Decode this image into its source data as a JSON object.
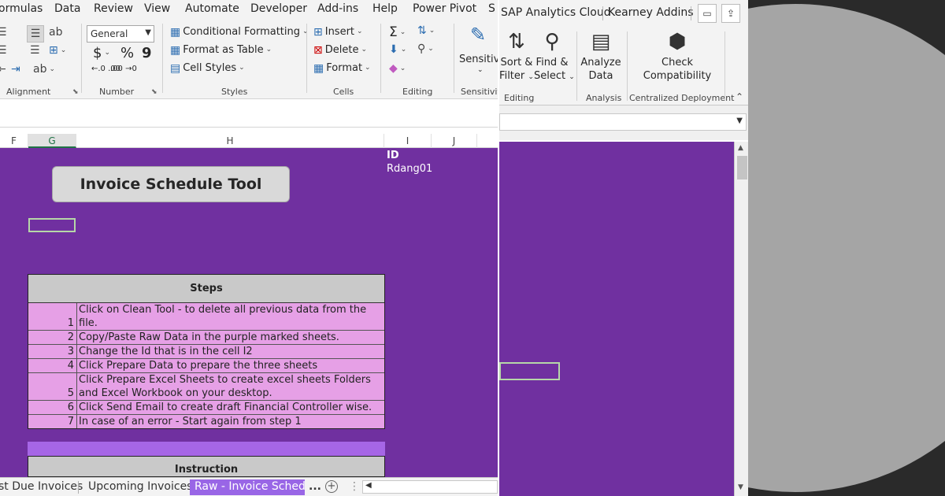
{
  "left_window": {
    "menu_tabs": [
      "ormulas",
      "Data",
      "Review",
      "View",
      "Automate",
      "Developer",
      "Add-ins",
      "Help",
      "Power Pivot",
      "S"
    ],
    "ribbon": {
      "number_format_value": "General",
      "group_labels": {
        "alignment": "Alignment",
        "number": "Number",
        "styles": "Styles",
        "cells": "Cells",
        "editing": "Editing",
        "sensitivity": "Sensitivit"
      },
      "styles_items": [
        "Conditional Formatting",
        "Format as Table",
        "Cell Styles"
      ],
      "cells_items": [
        "Insert",
        "Delete",
        "Format"
      ],
      "number_symbols": [
        "$",
        "%",
        "9"
      ],
      "sensitivity_label": "Sensitivit"
    },
    "columns": [
      "F",
      "G",
      "H",
      "I",
      "J"
    ],
    "sheet": {
      "title": "Invoice Schedule Tool",
      "id_label": "ID",
      "id_value": "Rdang01",
      "steps_header": "Steps",
      "steps": [
        {
          "num": "1",
          "text": "Click on Clean Tool - to delete all previous data from the file."
        },
        {
          "num": "2",
          "text": "Copy/Paste Raw Data in the purple marked sheets."
        },
        {
          "num": "3",
          "text": "Change the Id that is in the cell I2"
        },
        {
          "num": "4",
          "text": "Click Prepare Data to prepare the three sheets"
        },
        {
          "num": "5",
          "text": "Click Prepare Excel Sheets to create excel sheets Folders and Excel Workbook on your desktop."
        },
        {
          "num": "6",
          "text": "Click Send Email to create draft Financial Controller wise."
        },
        {
          "num": "7",
          "text": "In case of an error - Start again from step 1"
        }
      ],
      "instruction_header": "Instruction"
    },
    "sheet_tabs": {
      "tab1": "st Due Invoices",
      "tab2": "Upcoming Invoices",
      "tab3": "Raw - Invoice Schedule",
      "more": "..."
    }
  },
  "right_window": {
    "top_tabs": [
      "SAP Analytics Cloud",
      "Kearney Addins"
    ],
    "buttons": {
      "sort_filter": [
        "Sort &",
        "Filter"
      ],
      "find_select": [
        "Find &",
        "Select"
      ],
      "analyze_data": [
        "Analyze",
        "Data"
      ],
      "check_compat": [
        "Check",
        "Compatibility"
      ]
    },
    "group_labels": {
      "editing": "Editing",
      "analysis": "Analysis",
      "centralized": "Centralized Deployment"
    }
  },
  "colors": {
    "sheet_purple": "#7030a0",
    "steps_pink": "#e6a0e6",
    "accent_bar": "#a666e6",
    "active_tab": "#9966e6",
    "header_grey": "#c9c9c9"
  }
}
